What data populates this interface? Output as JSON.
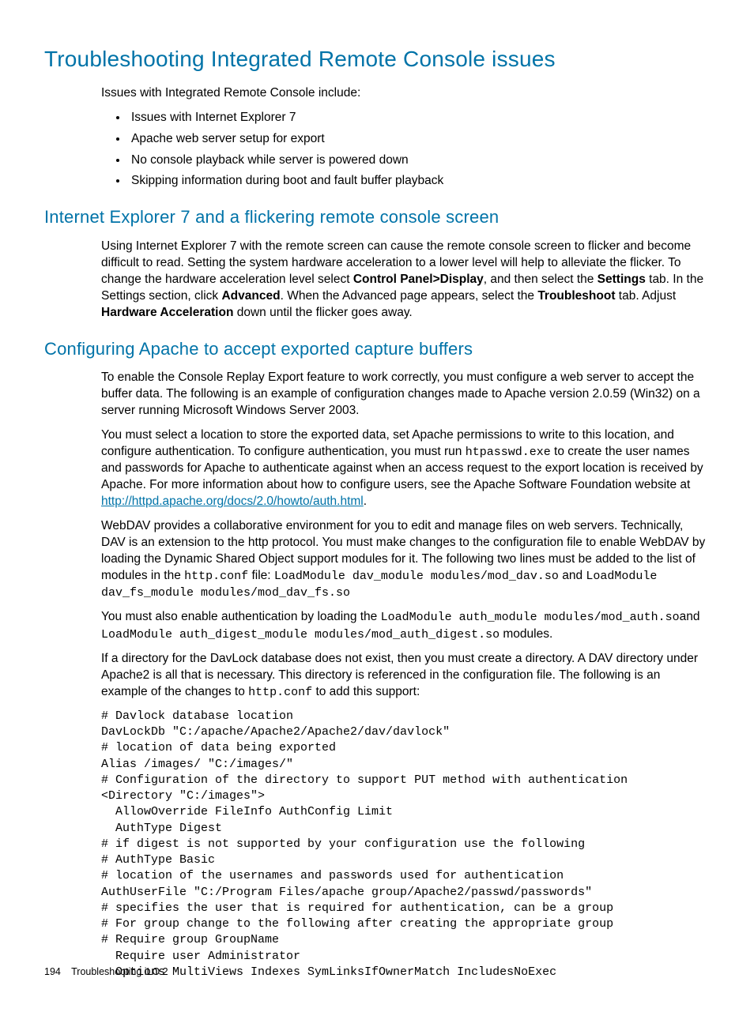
{
  "h1": "Troubleshooting Integrated Remote Console issues",
  "intro": "Issues with Integrated Remote Console include:",
  "bullets": [
    "Issues with Internet Explorer 7",
    "Apache web server setup for export",
    "No console playback while server is powered down",
    "Skipping information during boot and fault buffer playback"
  ],
  "h2a": "Internet Explorer 7 and a flickering remote console screen",
  "ie7": {
    "t1": "Using Internet Explorer 7 with the remote screen can cause the remote console screen to flicker and become difficult to read. Setting the system hardware acceleration to a lower level will help to alleviate the flicker. To change the hardware acceleration level select ",
    "b1": "Control Panel>Display",
    "t2": ", and then select the ",
    "b2": "Settings",
    "t3": " tab. In the Settings section, click ",
    "b3": "Advanced",
    "t4": ". When the Advanced page appears, select the ",
    "b4": "Troubleshoot",
    "t5": " tab. Adjust ",
    "b5": "Hardware Acceleration",
    "t6": " down until the flicker goes away."
  },
  "h2b": "Configuring Apache to accept exported capture buffers",
  "apache": {
    "p1": "To enable the Console Replay Export feature to work correctly, you must configure a web server to accept the buffer data. The following is an example of configuration changes made to Apache version 2.0.59 (Win32) on a server running Microsoft Windows Server 2003.",
    "p2a": "You must select a location to store the exported data, set Apache permissions to write to this location, and configure authentication. To configure authentication, you must run ",
    "p2code": "htpasswd.exe",
    "p2b": " to create the user names and passwords for Apache to authenticate against when an access request to the export location is received by Apache. For more information about how to configure users, see the Apache Software Foundation website at ",
    "p2link": "http://httpd.apache.org/docs/2.0/howto/auth.html",
    "p2c": ".",
    "p3a": "WebDAV provides a collaborative environment for you to edit and manage files on web servers. Technically, DAV is an extension to the http protocol. You must make changes to the configuration file to enable WebDAV by loading the Dynamic Shared Object support modules for it. The following two lines must be added to the list of modules in the ",
    "p3code1": "http.conf",
    "p3b": " file: ",
    "p3code2": "LoadModule dav_module modules/mod_dav.so",
    "p3c": " and ",
    "p3code3": "LoadModule dav_fs_module modules/mod_dav_fs.so",
    "p4a": "You must also enable authentication by loading the ",
    "p4code1": "LoadModule auth_module modules/mod_auth.so",
    "p4b": "and ",
    "p4code2": "LoadModule auth_digest_module modules/mod_auth_digest.so",
    "p4c": " modules.",
    "p5a": "If a directory for the DavLock database does not exist, then you must create a directory. A DAV directory under Apache2 is all that is necessary. This directory is referenced in the configuration file. The following is an example of the changes to ",
    "p5code": "http.conf",
    "p5b": " to add this support:"
  },
  "codeblock": "# Davlock database location\nDavLockDb \"C:/apache/Apache2/Apache2/dav/davlock\"\n# location of data being exported\nAlias /images/ \"C:/images/\"\n# Configuration of the directory to support PUT method with authentication\n<Directory \"C:/images\">\n  AllowOverride FileInfo AuthConfig Limit\n  AuthType Digest\n# if digest is not supported by your configuration use the following\n# AuthType Basic\n# location of the usernames and passwords used for authentication\nAuthUserFile \"C:/Program Files/apache group/Apache2/passwd/passwords\"\n# specifies the user that is required for authentication, can be a group\n# For group change to the following after creating the appropriate group\n# Require group GroupName\n  Require user Administrator\n  Options MultiViews Indexes SymLinksIfOwnerMatch IncludesNoExec",
  "footer": {
    "page": "194",
    "title": "Troubleshooting iLO 2"
  }
}
